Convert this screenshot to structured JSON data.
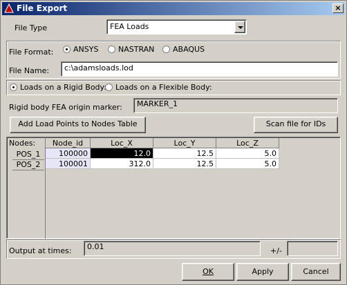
{
  "window": {
    "title": "File Export"
  },
  "file_type": {
    "label": "File Type",
    "value": "FEA Loads"
  },
  "file_format": {
    "label": "File Format:",
    "options": [
      "ANSYS",
      "NASTRAN",
      "ABAQUS"
    ],
    "selected": "ANSYS"
  },
  "file_name": {
    "label": "File Name:",
    "value": "c:\\adamsloads.lod"
  },
  "load_target": {
    "options": [
      "Loads on a Rigid Body:",
      "Loads on a Flexible Body:"
    ],
    "selected": "Loads on a Rigid Body:"
  },
  "origin_marker": {
    "label": "Rigid body FEA origin marker:",
    "value": "MARKER_1"
  },
  "buttons": {
    "add_load_points": "Add Load Points to Nodes Table",
    "scan_file": "Scan file for IDs",
    "ok": "OK",
    "apply": "Apply",
    "cancel": "Cancel"
  },
  "nodes_table": {
    "label": "Nodes:",
    "columns": [
      "Node_id",
      "Loc_X",
      "Loc_Y",
      "Loc_Z"
    ],
    "rows": [
      {
        "name": "POS_1",
        "node_id": "100000",
        "loc_x": "12.0",
        "loc_y": "12.5",
        "loc_z": "5.0"
      },
      {
        "name": "POS_2",
        "node_id": "100001",
        "loc_x": "312.0",
        "loc_y": "12.5",
        "loc_z": "5.0"
      }
    ]
  },
  "output": {
    "label": "Output at times:",
    "value": "0.01",
    "tolerance_label": "+/-",
    "tolerance_value": ""
  }
}
